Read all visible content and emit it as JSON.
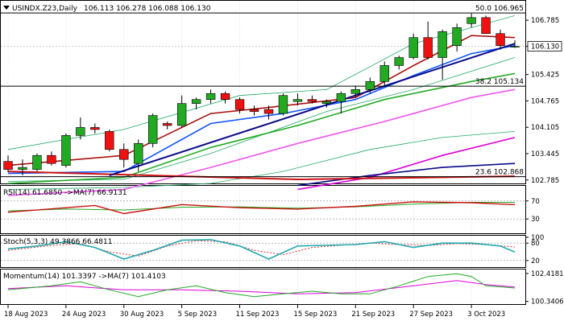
{
  "chart_data": {
    "type": "candlestick",
    "symbol_label": "USINDX.Z23,Daily",
    "ohlc_label": "106.113 106.278 106.088 106.130",
    "colors": {
      "up": "#22aa22",
      "down": "#ee1111",
      "wick": "#000000",
      "grid": "#c0c0c0"
    },
    "x_tick_labels": [
      "18 Aug 2023",
      "24 Aug 2023",
      "30 Aug 2023",
      "5 Sep 2023",
      "11 Sep 2023",
      "15 Sep 2023",
      "21 Sep 2023",
      "27 Sep 2023",
      "3 Oct 2023"
    ],
    "x_tick_indices": [
      0,
      4,
      8,
      12,
      16,
      20,
      24,
      28,
      32
    ],
    "price_panel": {
      "ylim": [
        102.7,
        107.25
      ],
      "y_ticks": [
        "106.785",
        "106.130",
        "105.425",
        "104.765",
        "104.105",
        "103.445",
        "102.785"
      ],
      "current_price": "106.130",
      "fib_levels": [
        {
          "label": "50.0 106.965",
          "value": 106.965
        },
        {
          "label": "38.2 105.134",
          "value": 105.134
        },
        {
          "label": "23.6 102.868",
          "value": 102.868
        }
      ],
      "candles": [
        {
          "o": 103.25,
          "h": 103.4,
          "l": 102.98,
          "c": 103.05
        },
        {
          "o": 103.05,
          "h": 103.3,
          "l": 102.9,
          "c": 103.1
        },
        {
          "o": 103.05,
          "h": 103.45,
          "l": 103.0,
          "c": 103.4
        },
        {
          "o": 103.4,
          "h": 103.5,
          "l": 103.15,
          "c": 103.2
        },
        {
          "o": 103.15,
          "h": 103.95,
          "l": 103.1,
          "c": 103.9
        },
        {
          "o": 103.9,
          "h": 104.35,
          "l": 103.8,
          "c": 104.1
        },
        {
          "o": 104.1,
          "h": 104.2,
          "l": 103.95,
          "c": 104.05
        },
        {
          "o": 104.0,
          "h": 104.05,
          "l": 103.5,
          "c": 103.55
        },
        {
          "o": 103.55,
          "h": 103.7,
          "l": 103.1,
          "c": 103.3
        },
        {
          "o": 103.2,
          "h": 103.8,
          "l": 103.0,
          "c": 103.7
        },
        {
          "o": 103.7,
          "h": 104.45,
          "l": 103.6,
          "c": 104.4
        },
        {
          "o": 104.2,
          "h": 104.25,
          "l": 104.05,
          "c": 104.15
        },
        {
          "o": 104.15,
          "h": 104.9,
          "l": 104.1,
          "c": 104.7
        },
        {
          "o": 104.7,
          "h": 104.85,
          "l": 104.55,
          "c": 104.8
        },
        {
          "o": 104.8,
          "h": 105.05,
          "l": 104.7,
          "c": 104.95
        },
        {
          "o": 104.95,
          "h": 105.0,
          "l": 104.7,
          "c": 104.8
        },
        {
          "o": 104.8,
          "h": 104.85,
          "l": 104.45,
          "c": 104.55
        },
        {
          "o": 104.55,
          "h": 104.65,
          "l": 104.4,
          "c": 104.5
        },
        {
          "o": 104.55,
          "h": 104.65,
          "l": 104.3,
          "c": 104.45
        },
        {
          "o": 104.45,
          "h": 104.95,
          "l": 104.4,
          "c": 104.9
        },
        {
          "o": 104.75,
          "h": 104.95,
          "l": 104.65,
          "c": 104.8
        },
        {
          "o": 104.8,
          "h": 104.9,
          "l": 104.7,
          "c": 104.75
        },
        {
          "o": 104.7,
          "h": 104.8,
          "l": 104.6,
          "c": 104.75
        },
        {
          "o": 104.75,
          "h": 105.0,
          "l": 104.45,
          "c": 104.95
        },
        {
          "o": 104.95,
          "h": 105.15,
          "l": 104.85,
          "c": 105.05
        },
        {
          "o": 105.05,
          "h": 105.35,
          "l": 104.95,
          "c": 105.25
        },
        {
          "o": 105.25,
          "h": 105.75,
          "l": 105.15,
          "c": 105.65
        },
        {
          "o": 105.65,
          "h": 105.9,
          "l": 105.55,
          "c": 105.85
        },
        {
          "o": 105.85,
          "h": 106.45,
          "l": 105.8,
          "c": 106.35
        },
        {
          "o": 106.35,
          "h": 106.75,
          "l": 105.8,
          "c": 105.85
        },
        {
          "o": 105.85,
          "h": 106.55,
          "l": 105.3,
          "c": 106.5
        },
        {
          "o": 106.15,
          "h": 106.7,
          "l": 106.0,
          "c": 106.6
        },
        {
          "o": 106.7,
          "h": 106.95,
          "l": 106.6,
          "c": 106.85
        },
        {
          "o": 106.85,
          "h": 106.9,
          "l": 106.45,
          "c": 106.45
        },
        {
          "o": 106.45,
          "h": 106.55,
          "l": 106.05,
          "c": 106.15
        },
        {
          "o": 106.11,
          "h": 106.28,
          "l": 106.09,
          "c": 106.13
        }
      ],
      "lines": [
        {
          "color": "#22aa66",
          "width": 0.8,
          "values": [
            [
              0,
              103.55
            ],
            [
              8,
              104.05
            ],
            [
              16,
              104.9
            ],
            [
              22,
              105.05
            ],
            [
              28,
              106.2
            ],
            [
              35,
              106.9
            ]
          ]
        },
        {
          "color": "#22aa66",
          "width": 0.8,
          "values": [
            [
              0,
              102.75
            ],
            [
              8,
              102.8
            ],
            [
              14,
              103.45
            ],
            [
              22,
              104.5
            ],
            [
              28,
              105.05
            ],
            [
              35,
              105.85
            ]
          ]
        },
        {
          "color": "#22aa66",
          "width": 0.8,
          "values": [
            [
              0,
              102.55
            ],
            [
              8,
              102.6
            ],
            [
              14,
              102.7
            ],
            [
              19,
              103.0
            ],
            [
              25,
              103.55
            ],
            [
              30,
              103.85
            ],
            [
              35,
              104.0
            ]
          ]
        },
        {
          "color": "#1155ff",
          "width": 1.6,
          "values": [
            [
              0,
              102.95
            ],
            [
              8,
              103.0
            ],
            [
              14,
              104.2
            ],
            [
              19,
              104.45
            ],
            [
              24,
              104.8
            ],
            [
              28,
              105.4
            ],
            [
              32,
              105.95
            ],
            [
              35,
              106.15
            ]
          ]
        },
        {
          "color": "#aa1111",
          "width": 1.6,
          "values": [
            [
              0,
              103.15
            ],
            [
              8,
              103.4
            ],
            [
              14,
              104.45
            ],
            [
              18,
              104.6
            ],
            [
              24,
              104.85
            ],
            [
              28,
              105.65
            ],
            [
              32,
              106.4
            ],
            [
              35,
              106.35
            ]
          ]
        },
        {
          "color": "#22aa22",
          "width": 1.6,
          "values": [
            [
              0,
              102.7
            ],
            [
              8,
              102.85
            ],
            [
              14,
              103.6
            ],
            [
              20,
              104.15
            ],
            [
              26,
              104.8
            ],
            [
              32,
              105.25
            ],
            [
              35,
              105.45
            ]
          ]
        },
        {
          "color": "#ee55ee",
          "width": 1.6,
          "values": [
            [
              0,
              102.4
            ],
            [
              8,
              102.55
            ],
            [
              14,
              103.1
            ],
            [
              20,
              103.7
            ],
            [
              26,
              104.25
            ],
            [
              32,
              104.85
            ],
            [
              35,
              105.05
            ]
          ]
        },
        {
          "color": "#dd00dd",
          "width": 1.6,
          "values": [
            [
              20,
              102.55
            ],
            [
              25,
              102.85
            ],
            [
              30,
              103.4
            ],
            [
              35,
              103.85
            ]
          ]
        },
        {
          "color": "#0a0a88",
          "width": 1.6,
          "values": [
            [
              20,
              102.65
            ],
            [
              25,
              102.9
            ],
            [
              30,
              103.1
            ],
            [
              35,
              103.2
            ]
          ]
        },
        {
          "color": "#cc1111",
          "width": 2,
          "values": [
            [
              0,
              103.0
            ],
            [
              20,
              102.8
            ],
            [
              35,
              102.88
            ]
          ]
        },
        {
          "color": "#0a0a88",
          "width": 2,
          "values": [
            [
              7,
              102.9
            ],
            [
              35,
              106.2
            ]
          ]
        }
      ]
    },
    "rsi_panel": {
      "label": "RSI(14) 61.6850   ->MA(7) 66.9131",
      "ylim": [
        0,
        100
      ],
      "y_ticks": [
        "70",
        "30"
      ],
      "levels": [
        70,
        30
      ],
      "rsi": [
        [
          0,
          45
        ],
        [
          4,
          55
        ],
        [
          6,
          60
        ],
        [
          8,
          42
        ],
        [
          12,
          62
        ],
        [
          16,
          55
        ],
        [
          20,
          52
        ],
        [
          24,
          58
        ],
        [
          28,
          68
        ],
        [
          32,
          66
        ],
        [
          35,
          61.7
        ]
      ],
      "ma": [
        [
          0,
          48
        ],
        [
          4,
          52
        ],
        [
          8,
          50
        ],
        [
          12,
          56
        ],
        [
          16,
          57
        ],
        [
          20,
          54
        ],
        [
          24,
          57
        ],
        [
          28,
          63
        ],
        [
          32,
          67
        ],
        [
          35,
          66.9
        ]
      ],
      "colors": {
        "rsi": "#cc1111",
        "ma": "#22aa22"
      }
    },
    "stoch_panel": {
      "label": "Stoch(5,3,3) 49.3866 66.4811",
      "ylim": [
        0,
        100
      ],
      "y_ticks": [
        "100",
        "80",
        "20"
      ],
      "levels": [
        80,
        20
      ],
      "main": [
        [
          0,
          60
        ],
        [
          2,
          70
        ],
        [
          4,
          85
        ],
        [
          6,
          65
        ],
        [
          8,
          25
        ],
        [
          10,
          55
        ],
        [
          12,
          90
        ],
        [
          14,
          92
        ],
        [
          16,
          70
        ],
        [
          18,
          25
        ],
        [
          20,
          70
        ],
        [
          24,
          75
        ],
        [
          26,
          85
        ],
        [
          28,
          65
        ],
        [
          30,
          80
        ],
        [
          32,
          80
        ],
        [
          34,
          70
        ],
        [
          35,
          49.4
        ]
      ],
      "signal": [
        [
          0,
          55
        ],
        [
          3,
          72
        ],
        [
          5,
          78
        ],
        [
          7,
          50
        ],
        [
          9,
          35
        ],
        [
          11,
          70
        ],
        [
          13,
          88
        ],
        [
          15,
          85
        ],
        [
          17,
          55
        ],
        [
          19,
          40
        ],
        [
          21,
          65
        ],
        [
          25,
          80
        ],
        [
          27,
          75
        ],
        [
          29,
          72
        ],
        [
          31,
          78
        ],
        [
          33,
          75
        ],
        [
          35,
          66.5
        ]
      ],
      "colors": {
        "main": "#20aab0",
        "signal": "#dd3333"
      }
    },
    "momentum_panel": {
      "label": "Momentum(14) 101.3397   ->MA(7) 101.4103",
      "ylim": [
        100.2,
        102.6
      ],
      "y_ticks": [
        "102.4181",
        "100.3406"
      ],
      "momentum": [
        [
          0,
          101.2
        ],
        [
          3,
          101.5
        ],
        [
          5,
          101.8
        ],
        [
          7,
          101.2
        ],
        [
          9,
          100.7
        ],
        [
          11,
          101.2
        ],
        [
          13,
          101.5
        ],
        [
          15,
          101.0
        ],
        [
          17,
          100.7
        ],
        [
          19,
          100.9
        ],
        [
          21,
          101.1
        ],
        [
          23,
          100.9
        ],
        [
          25,
          100.9
        ],
        [
          27,
          101.5
        ],
        [
          29,
          102.2
        ],
        [
          31,
          102.4
        ],
        [
          32,
          102.2
        ],
        [
          33,
          101.5
        ],
        [
          35,
          101.34
        ]
      ],
      "ma": [
        [
          0,
          101.3
        ],
        [
          4,
          101.5
        ],
        [
          8,
          101.2
        ],
        [
          12,
          101.2
        ],
        [
          16,
          101.1
        ],
        [
          20,
          100.9
        ],
        [
          24,
          101.0
        ],
        [
          28,
          101.5
        ],
        [
          31,
          101.9
        ],
        [
          33,
          101.6
        ],
        [
          35,
          101.41
        ]
      ],
      "colors": {
        "momentum": "#22aa22",
        "ma": "#dd00dd"
      }
    }
  }
}
